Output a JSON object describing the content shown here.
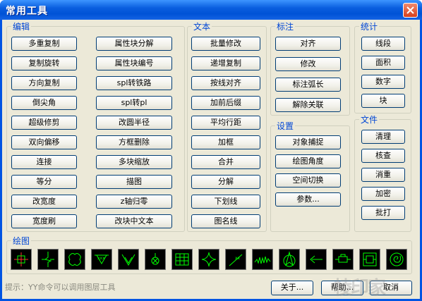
{
  "window": {
    "title": "常用工具"
  },
  "groups": {
    "edit": {
      "label": "编辑",
      "col1": [
        "多重复制",
        "复制旋转",
        "方向复制",
        "倒尖角",
        "超级修剪",
        "双向偏移",
        "连接",
        "等分",
        "改宽度",
        "宽度刷"
      ],
      "col2": [
        "属性块分解",
        "属性块编号",
        "spl转铁路",
        "spl转pl",
        "改圆半径",
        "方框删除",
        "多块缩放",
        "描图",
        "z轴归零",
        "改块中文本"
      ]
    },
    "text": {
      "label": "文本",
      "items": [
        "批量修改",
        "递增复制",
        "按线对齐",
        "加前后缀",
        "平均行距",
        "加框",
        "合并",
        "分解",
        "下划线",
        "图名线"
      ]
    },
    "dim": {
      "label": "标注",
      "items": [
        "对齐",
        "修改",
        "标注弧长",
        "解除关联"
      ]
    },
    "settings": {
      "label": "设置",
      "items": [
        "对象捕捉",
        "绘图角度",
        "空间切换",
        "参数..."
      ]
    },
    "stats": {
      "label": "统计",
      "items": [
        "线段",
        "面积",
        "数字",
        "块"
      ]
    },
    "file": {
      "label": "文件",
      "items": [
        "清理",
        "核查",
        "消重",
        "加密",
        "批打"
      ]
    },
    "draw": {
      "label": "绘图",
      "icons": [
        "crosshair-target-icon",
        "break-line-icon",
        "cloud-outline-icon",
        "cross-section-icon",
        "triangle-mark-icon",
        "circle-cross-icon",
        "grid-table-icon",
        "four-point-star-icon",
        "slope-line-icon",
        "zigzag-break-icon",
        "north-arrow-icon",
        "arrow-left-icon",
        "component-block-icon",
        "frame-block-icon",
        "spiral-circle-icon"
      ]
    }
  },
  "hint": "提示：YY命令可以调用图层工具",
  "footer": {
    "about": "关于...",
    "help": "帮助...",
    "cancel": "取消"
  },
  "watermark": "棱印家"
}
